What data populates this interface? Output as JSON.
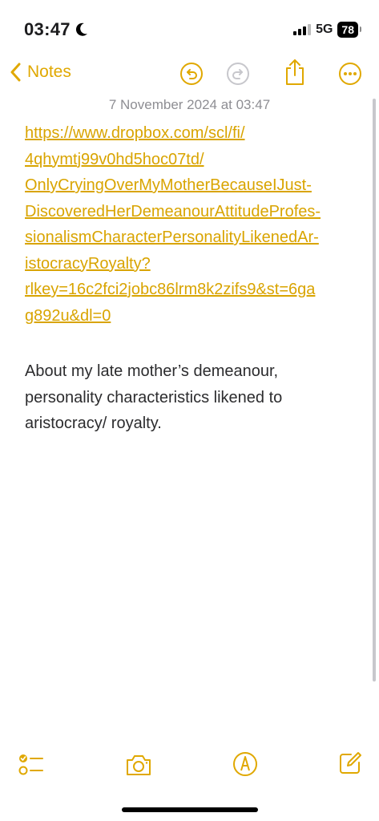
{
  "status_bar": {
    "time": "03:47",
    "network": "5G",
    "battery": "78"
  },
  "nav": {
    "back_label": "Notes"
  },
  "note": {
    "date": "7 November 2024 at 03:47",
    "link_lines": [
      "https://www.dropbox.com/scl/fi/",
      "4qhymtj99v0hd5hoc07td/",
      "OnlyCryingOverMyMotherBecauseIJust-",
      "DiscoveredHerDemeanourAttitudeProfes-",
      "sionalismCharacterPersonalityLikenedAr-",
      "istocracyRoyalty?",
      "rlkey=16c2fci2jobc86lrm8k2zifs9&st=6ga",
      "g892u&dl=0"
    ],
    "body_lines": [
      "About my late mother’s demeanour,",
      "personality characteristics likened to",
      "aristocracy/ royalty."
    ]
  },
  "colors": {
    "accent": "#e0a800",
    "text": "#2c2c2e",
    "secondary": "#8e8e93"
  }
}
